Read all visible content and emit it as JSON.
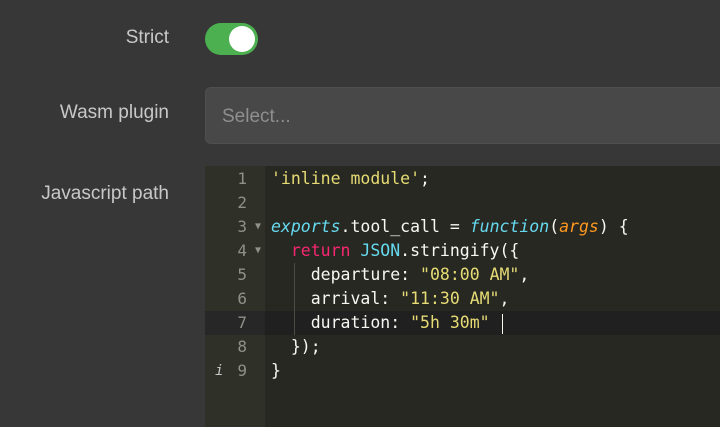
{
  "form": {
    "strict_label": "Strict",
    "strict_enabled": true,
    "wasm_label": "Wasm plugin",
    "wasm_placeholder": "Select...",
    "js_label": "Javascript path"
  },
  "colors": {
    "toggle_on": "#4caf50",
    "editor_bg": "#272822",
    "string": "#e6db74",
    "keyword": "#f92672",
    "function": "#66d9ef",
    "param": "#fd971f"
  },
  "editor": {
    "active_line": 7,
    "line_numbers": [
      "1",
      "2",
      "3",
      "4",
      "5",
      "6",
      "7",
      "8",
      "9"
    ],
    "info_marker": "i",
    "lines": {
      "l1": {
        "str": "'inline module'",
        "punct": ";"
      },
      "l3": {
        "obj": "exports",
        "dot": ".",
        "prop": "tool_call",
        "eq": " = ",
        "kw": "function",
        "open": "(",
        "param": "args",
        "close": ") {"
      },
      "l4": {
        "kw": "return",
        "obj": " JSON",
        "rest": ".stringify({"
      },
      "l5": {
        "key": "departure: ",
        "val": "\"08:00 AM\"",
        "punct": ","
      },
      "l6": {
        "key": "arrival: ",
        "val": "\"11:30 AM\"",
        "punct": ","
      },
      "l7": {
        "key": "duration: ",
        "val": "\"5h 30m\"",
        "punct": " "
      },
      "l8": {
        "text": "});"
      },
      "l9": {
        "text": "}"
      }
    }
  }
}
